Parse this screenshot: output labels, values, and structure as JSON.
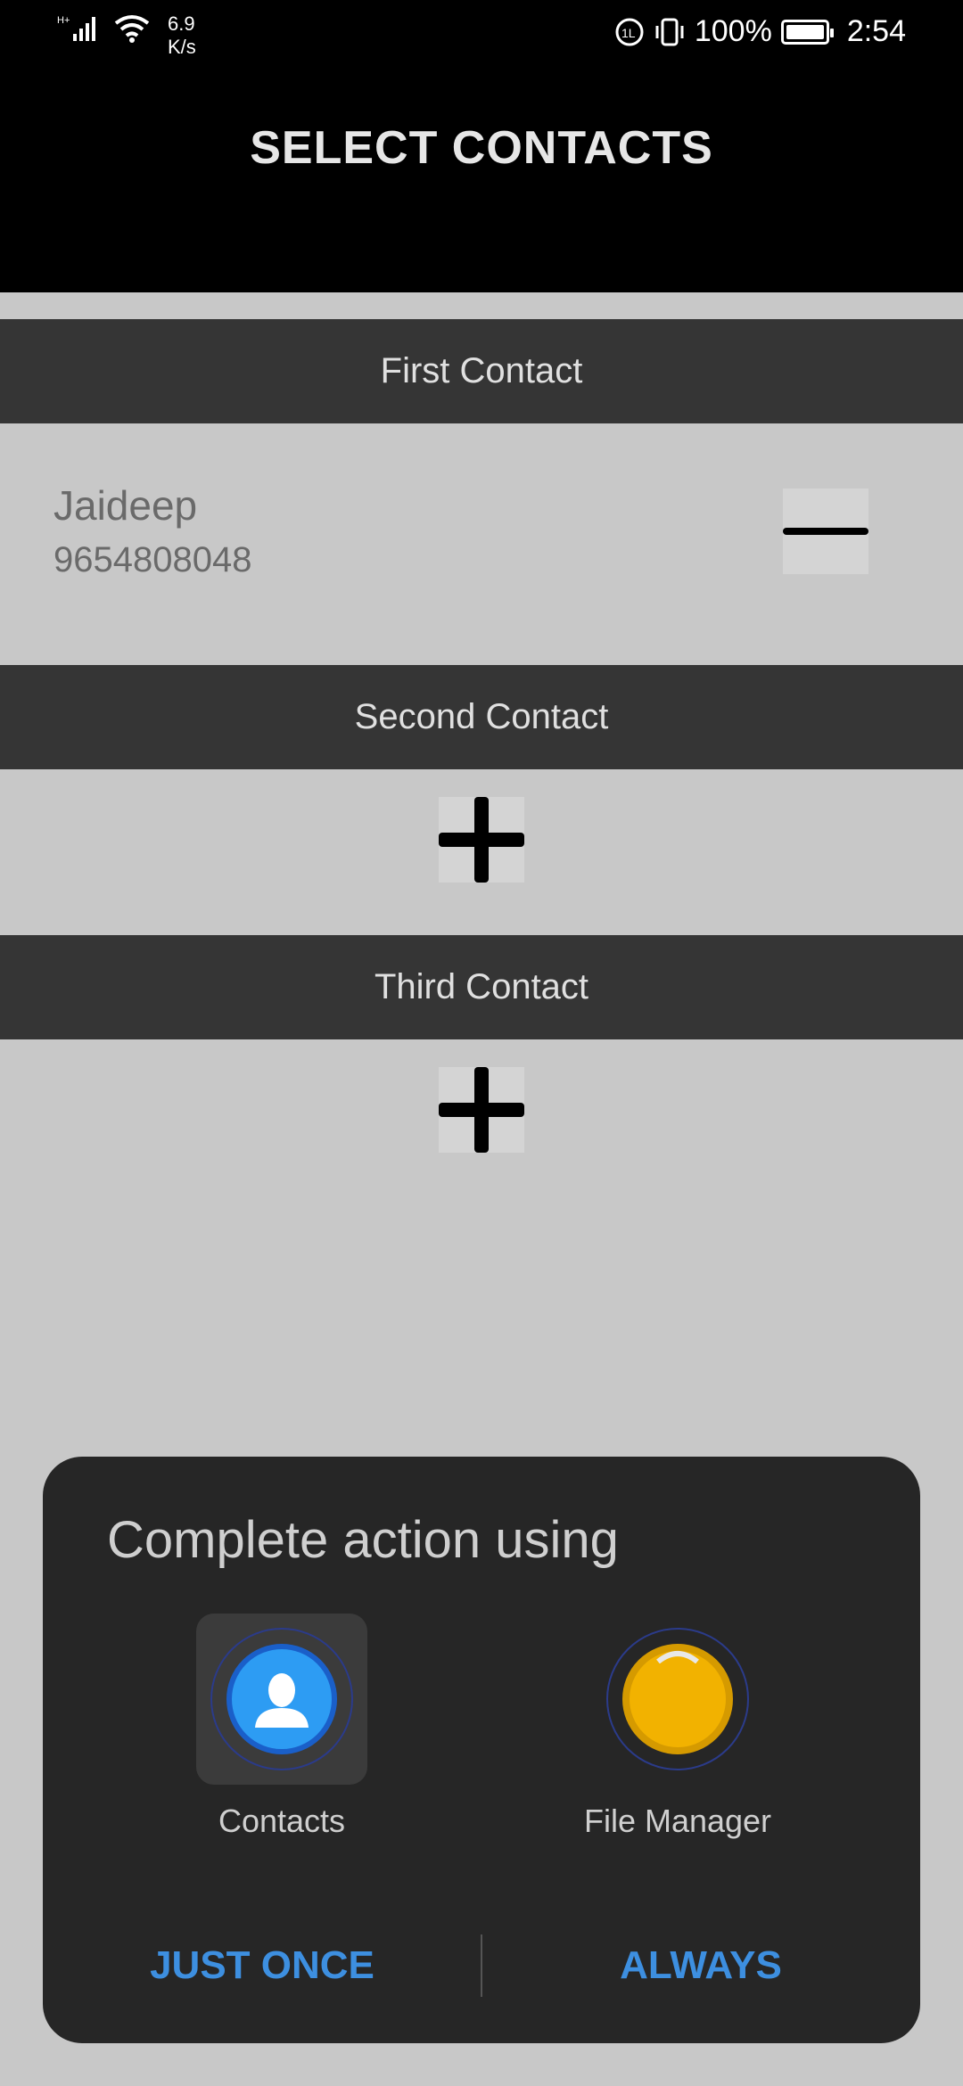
{
  "status_bar": {
    "network_type": "H+",
    "speed_value": "6.9",
    "speed_unit": "K/s",
    "battery": "100%",
    "time": "2:54",
    "icons": [
      "signal-icon",
      "wifi-icon",
      "data-saver-icon",
      "vibrate-icon",
      "battery-icon"
    ]
  },
  "app_bar": {
    "title": "SELECT CONTACTS"
  },
  "sections": {
    "first": {
      "header": "First Contact",
      "name": "Jaideep",
      "phone": "9654808048"
    },
    "second": {
      "header": "Second Contact"
    },
    "third": {
      "header": "Third Contact"
    }
  },
  "dialog": {
    "title": "Complete action using",
    "apps": [
      {
        "label": "Contacts",
        "icon": "contacts-app-icon",
        "selected": true
      },
      {
        "label": "File Manager",
        "icon": "file-manager-app-icon",
        "selected": false
      }
    ],
    "buttons": {
      "just_once": "JUST ONCE",
      "always": "ALWAYS"
    }
  },
  "colors": {
    "background": "#c8c8c8",
    "header_bg": "#353535",
    "dialog_bg": "#262626",
    "accent": "#3d8fe0"
  }
}
